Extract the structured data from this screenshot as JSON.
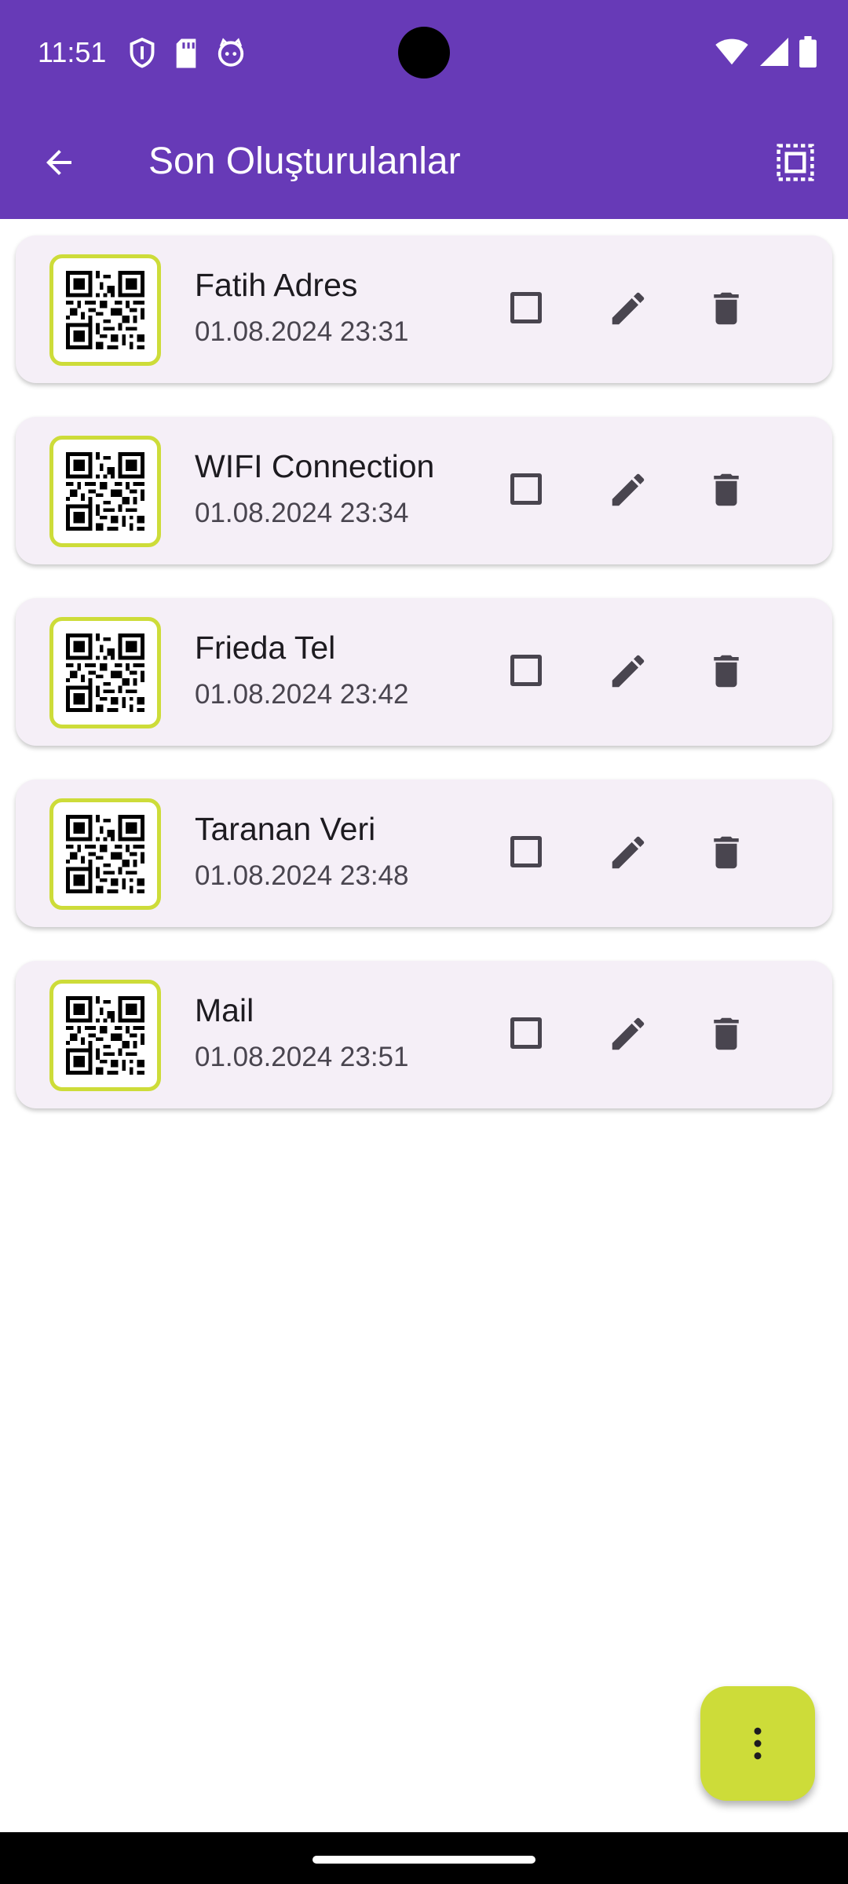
{
  "status_bar": {
    "time": "11:51"
  },
  "app_bar": {
    "title": "Son Oluşturulanlar"
  },
  "items": [
    {
      "name": "Fatih Adres",
      "date": "01.08.2024 23:31"
    },
    {
      "name": "WIFI Connection",
      "date": "01.08.2024 23:34"
    },
    {
      "name": "Frieda Tel",
      "date": "01.08.2024 23:42"
    },
    {
      "name": "Taranan Veri",
      "date": "01.08.2024 23:48"
    },
    {
      "name": "Mail",
      "date": "01.08.2024 23:51"
    }
  ],
  "colors": {
    "primary": "#673ab7",
    "accent": "#cddc39",
    "card": "#f5eff7"
  },
  "icons": {
    "back": "arrow-back-icon",
    "select_all": "select-all-icon",
    "item_thumbnail": "qr-code-icon",
    "edit": "pencil-icon",
    "delete": "trash-icon",
    "fab": "more-vert-icon"
  }
}
